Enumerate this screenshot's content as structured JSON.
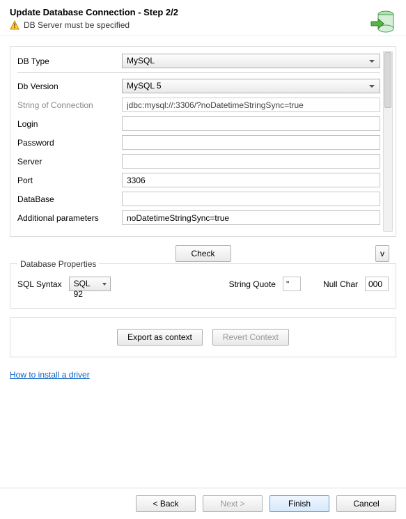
{
  "header": {
    "title": "Update Database Connection - Step 2/2",
    "warning": "DB Server must be specified"
  },
  "form": {
    "dbType": {
      "label": "DB Type",
      "value": "MySQL"
    },
    "dbVersion": {
      "label": "Db Version",
      "value": "MySQL 5"
    },
    "connString": {
      "label": "String of Connection",
      "value": "jdbc:mysql://:3306/?noDatetimeStringSync=true"
    },
    "login": {
      "label": "Login",
      "value": ""
    },
    "password": {
      "label": "Password",
      "value": ""
    },
    "server": {
      "label": "Server",
      "value": ""
    },
    "port": {
      "label": "Port",
      "value": "3306"
    },
    "database": {
      "label": "DataBase",
      "value": ""
    },
    "additional": {
      "label": "Additional parameters",
      "value": "noDatetimeStringSync=true"
    }
  },
  "buttons": {
    "check": "Check",
    "expand": "v",
    "exportContext": "Export as context",
    "revertContext": "Revert Context",
    "back": "< Back",
    "next": "Next >",
    "finish": "Finish",
    "cancel": "Cancel"
  },
  "dbProps": {
    "legend": "Database Properties",
    "sqlSyntax": {
      "label": "SQL Syntax",
      "value": "SQL 92"
    },
    "stringQuote": {
      "label": "String Quote",
      "value": "\""
    },
    "nullChar": {
      "label": "Null Char",
      "value": "000"
    }
  },
  "link": {
    "install": "How to install a driver"
  }
}
